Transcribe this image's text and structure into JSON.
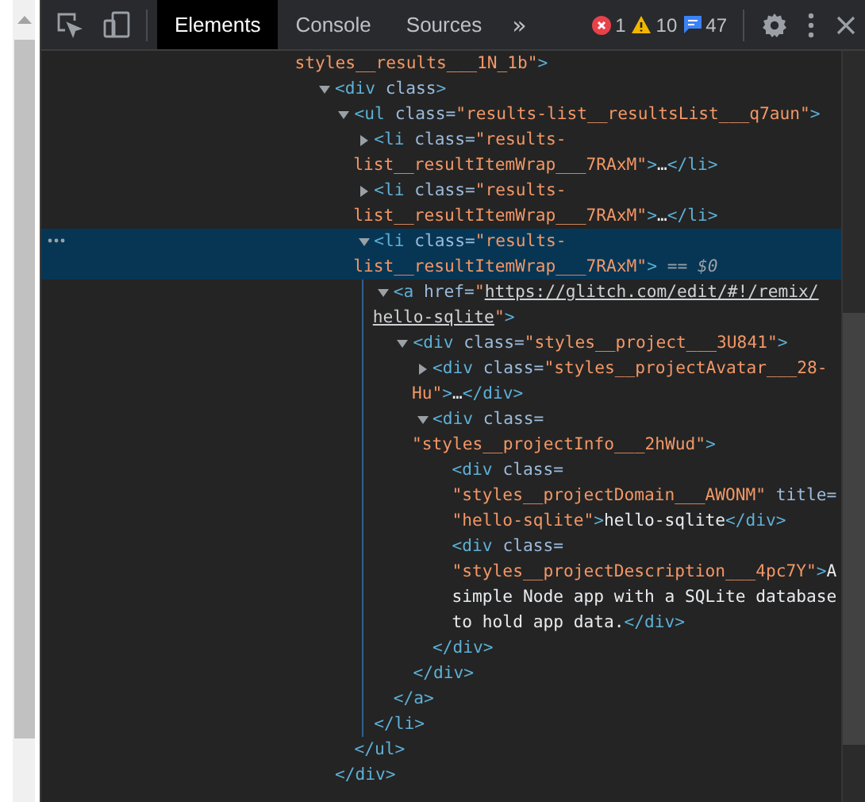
{
  "toolbar": {
    "tabs": [
      {
        "label": "Elements",
        "selected": true
      },
      {
        "label": "Console",
        "selected": false
      },
      {
        "label": "Sources",
        "selected": false
      }
    ],
    "more_tabs": "»",
    "errors": "1",
    "warnings": "10",
    "messages": "47"
  },
  "context_line": [
    {
      "kind": "value",
      "s": "styles__results___1N_1b\""
    },
    {
      "kind": "tag",
      "s": ">"
    }
  ],
  "tree": [
    {
      "kind": "branch",
      "expanded": true,
      "selected": false,
      "open": [
        [
          {
            "kind": "tag",
            "s": "<div"
          },
          {
            "kind": "attr",
            "s": " class"
          },
          {
            "kind": "tag",
            "s": ">"
          }
        ]
      ],
      "close": [
        {
          "kind": "tag",
          "s": "</div>"
        }
      ],
      "children": [
        {
          "kind": "branch",
          "expanded": true,
          "selected": false,
          "open": [
            [
              {
                "kind": "tag",
                "s": "<ul"
              },
              {
                "kind": "attr",
                "s": " class"
              },
              {
                "kind": "eq",
                "s": "="
              },
              {
                "kind": "value",
                "s": "\"results-list__resultsList___q7aun\""
              },
              {
                "kind": "tag",
                "s": ">"
              }
            ]
          ],
          "close": [
            {
              "kind": "tag",
              "s": "</ul>"
            }
          ],
          "children": [
            {
              "kind": "branch",
              "expanded": false,
              "selected": false,
              "open": [
                [
                  {
                    "kind": "tag",
                    "s": "<li"
                  },
                  {
                    "kind": "attr",
                    "s": " class"
                  },
                  {
                    "kind": "eq",
                    "s": "="
                  },
                  {
                    "kind": "value",
                    "s": "\"results-"
                  }
                ],
                [
                  {
                    "kind": "value",
                    "s": "list__resultItemWrap___7RAxM\""
                  },
                  {
                    "kind": "tag",
                    "s": ">"
                  },
                  {
                    "kind": "text",
                    "s": "…"
                  },
                  {
                    "kind": "tag",
                    "s": "</li>"
                  }
                ]
              ]
            },
            {
              "kind": "branch",
              "expanded": false,
              "selected": false,
              "open": [
                [
                  {
                    "kind": "tag",
                    "s": "<li"
                  },
                  {
                    "kind": "attr",
                    "s": " class"
                  },
                  {
                    "kind": "eq",
                    "s": "="
                  },
                  {
                    "kind": "value",
                    "s": "\"results-"
                  }
                ],
                [
                  {
                    "kind": "value",
                    "s": "list__resultItemWrap___7RAxM\""
                  },
                  {
                    "kind": "tag",
                    "s": ">"
                  },
                  {
                    "kind": "text",
                    "s": "…"
                  },
                  {
                    "kind": "tag",
                    "s": "</li>"
                  }
                ]
              ]
            },
            {
              "kind": "branch",
              "expanded": true,
              "selected": true,
              "open": [
                [
                  {
                    "kind": "tag",
                    "s": "<li"
                  },
                  {
                    "kind": "attr",
                    "s": " class"
                  },
                  {
                    "kind": "eq",
                    "s": "="
                  },
                  {
                    "kind": "value",
                    "s": "\"results-"
                  }
                ],
                [
                  {
                    "kind": "value",
                    "s": "list__resultItemWrap___7RAxM\""
                  },
                  {
                    "kind": "tag",
                    "s": ">"
                  },
                  {
                    "kind": "marker",
                    "s": " == "
                  },
                  {
                    "kind": "var",
                    "s": "$0"
                  }
                ]
              ],
              "close": [
                {
                  "kind": "tag",
                  "s": "</li>"
                }
              ],
              "children": [
                {
                  "kind": "branch",
                  "expanded": true,
                  "selected": false,
                  "open": [
                    [
                      {
                        "kind": "tag",
                        "s": "<a"
                      },
                      {
                        "kind": "attr",
                        "s": " href"
                      },
                      {
                        "kind": "eq",
                        "s": "="
                      },
                      {
                        "kind": "value",
                        "s": "\""
                      },
                      {
                        "kind": "link",
                        "s": "https://glitch.com/edit/#!/remix/"
                      }
                    ],
                    [
                      {
                        "kind": "link",
                        "s": "hello-sqlite"
                      },
                      {
                        "kind": "value",
                        "s": "\""
                      },
                      {
                        "kind": "tag",
                        "s": ">"
                      }
                    ]
                  ],
                  "close": [
                    {
                      "kind": "tag",
                      "s": "</a>"
                    }
                  ],
                  "children": [
                    {
                      "kind": "branch",
                      "expanded": true,
                      "selected": false,
                      "open": [
                        [
                          {
                            "kind": "tag",
                            "s": "<div"
                          },
                          {
                            "kind": "attr",
                            "s": " class"
                          },
                          {
                            "kind": "eq",
                            "s": "="
                          },
                          {
                            "kind": "value",
                            "s": "\"styles__project___3U841\""
                          },
                          {
                            "kind": "tag",
                            "s": ">"
                          }
                        ]
                      ],
                      "close": [
                        {
                          "kind": "tag",
                          "s": "</div>"
                        }
                      ],
                      "children": [
                        {
                          "kind": "branch",
                          "expanded": false,
                          "selected": false,
                          "open": [
                            [
                              {
                                "kind": "tag",
                                "s": "<div"
                              },
                              {
                                "kind": "attr",
                                "s": " class"
                              },
                              {
                                "kind": "eq",
                                "s": "="
                              },
                              {
                                "kind": "value",
                                "s": "\"styles__projectAvatar___28-"
                              }
                            ],
                            [
                              {
                                "kind": "value",
                                "s": "Hu\""
                              },
                              {
                                "kind": "tag",
                                "s": ">"
                              },
                              {
                                "kind": "text",
                                "s": "…"
                              },
                              {
                                "kind": "tag",
                                "s": "</div>"
                              }
                            ]
                          ]
                        },
                        {
                          "kind": "branch",
                          "expanded": true,
                          "selected": false,
                          "open": [
                            [
                              {
                                "kind": "tag",
                                "s": "<div"
                              },
                              {
                                "kind": "attr",
                                "s": " class"
                              },
                              {
                                "kind": "eq",
                                "s": "="
                              }
                            ],
                            [
                              {
                                "kind": "value",
                                "s": "\"styles__projectInfo___2hWud\""
                              },
                              {
                                "kind": "tag",
                                "s": ">"
                              }
                            ]
                          ],
                          "close": [
                            {
                              "kind": "tag",
                              "s": "</div>"
                            }
                          ],
                          "children": [
                            {
                              "kind": "leaf",
                              "selected": false,
                              "open": [
                                [
                                  {
                                    "kind": "tag",
                                    "s": "<div"
                                  },
                                  {
                                    "kind": "attr",
                                    "s": " class"
                                  },
                                  {
                                    "kind": "eq",
                                    "s": "="
                                  }
                                ],
                                [
                                  {
                                    "kind": "value",
                                    "s": "\"styles__projectDomain___AWONM\""
                                  },
                                  {
                                    "kind": "attr",
                                    "s": " title"
                                  },
                                  {
                                    "kind": "eq",
                                    "s": "="
                                  }
                                ],
                                [
                                  {
                                    "kind": "value",
                                    "s": "\"hello-sqlite\""
                                  },
                                  {
                                    "kind": "tag",
                                    "s": ">"
                                  },
                                  {
                                    "kind": "text",
                                    "s": "hello-sqlite"
                                  },
                                  {
                                    "kind": "tag",
                                    "s": "</div>"
                                  }
                                ]
                              ]
                            },
                            {
                              "kind": "leaf",
                              "selected": false,
                              "open": [
                                [
                                  {
                                    "kind": "tag",
                                    "s": "<div"
                                  },
                                  {
                                    "kind": "attr",
                                    "s": " class"
                                  },
                                  {
                                    "kind": "eq",
                                    "s": "="
                                  }
                                ],
                                [
                                  {
                                    "kind": "value",
                                    "s": "\"styles__projectDescription___4pc7Y\""
                                  },
                                  {
                                    "kind": "tag",
                                    "s": ">"
                                  },
                                  {
                                    "kind": "text",
                                    "s": "A"
                                  }
                                ],
                                [
                                  {
                                    "kind": "text",
                                    "s": "simple Node app with a SQLite database"
                                  }
                                ],
                                [
                                  {
                                    "kind": "text",
                                    "s": "to hold app data."
                                  },
                                  {
                                    "kind": "tag",
                                    "s": "</div>"
                                  }
                                ]
                              ]
                            }
                          ]
                        }
                      ]
                    }
                  ]
                }
              ]
            }
          ]
        }
      ]
    }
  ]
}
